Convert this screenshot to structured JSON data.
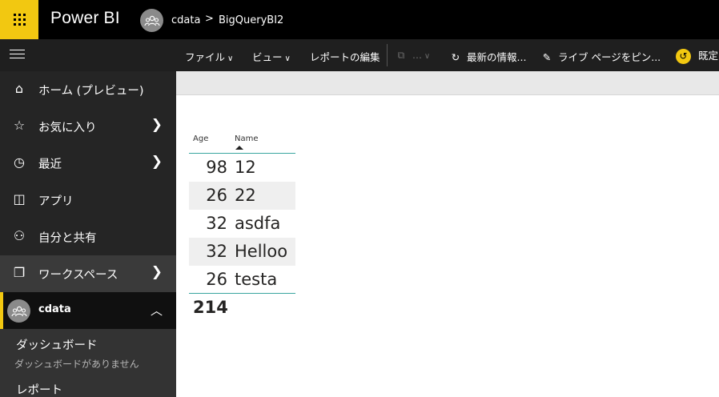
{
  "header": {
    "brand": "Power BI",
    "breadcrumb": {
      "workspace": "cdata",
      "separator": ">",
      "report": "BigQueryBI2"
    }
  },
  "commandbar": {
    "file": "ファイル",
    "view": "ビュー",
    "edit_report": "レポートの編集",
    "disabled_ellipsis": "...",
    "refresh": "最新の情報...",
    "pin_live": "ライブ ページをピン...",
    "default": "既定"
  },
  "sidebar": {
    "items": [
      {
        "label": "ホーム (プレビュー)"
      },
      {
        "label": "お気に入り"
      },
      {
        "label": "最近"
      },
      {
        "label": "アプリ"
      },
      {
        "label": "自分と共有"
      },
      {
        "label": "ワークスペース"
      },
      {
        "label": "cdata"
      }
    ],
    "sub": {
      "dashboards": "ダッシュボード",
      "no_dashboards": "ダッシュボードがありません",
      "reports": "レポート"
    }
  },
  "table": {
    "headers": {
      "age": "Age",
      "name": "Name"
    },
    "rows": [
      {
        "age": "98",
        "name": "12"
      },
      {
        "age": "26",
        "name": "22"
      },
      {
        "age": "32",
        "name": "asdfa"
      },
      {
        "age": "32",
        "name": "Helloo"
      },
      {
        "age": "26",
        "name": "testa"
      }
    ],
    "total": "214"
  },
  "colors": {
    "accent_yellow": "#f2c811",
    "table_rule": "#3aa6a0",
    "sidebar_bg": "#2b2b2b"
  }
}
